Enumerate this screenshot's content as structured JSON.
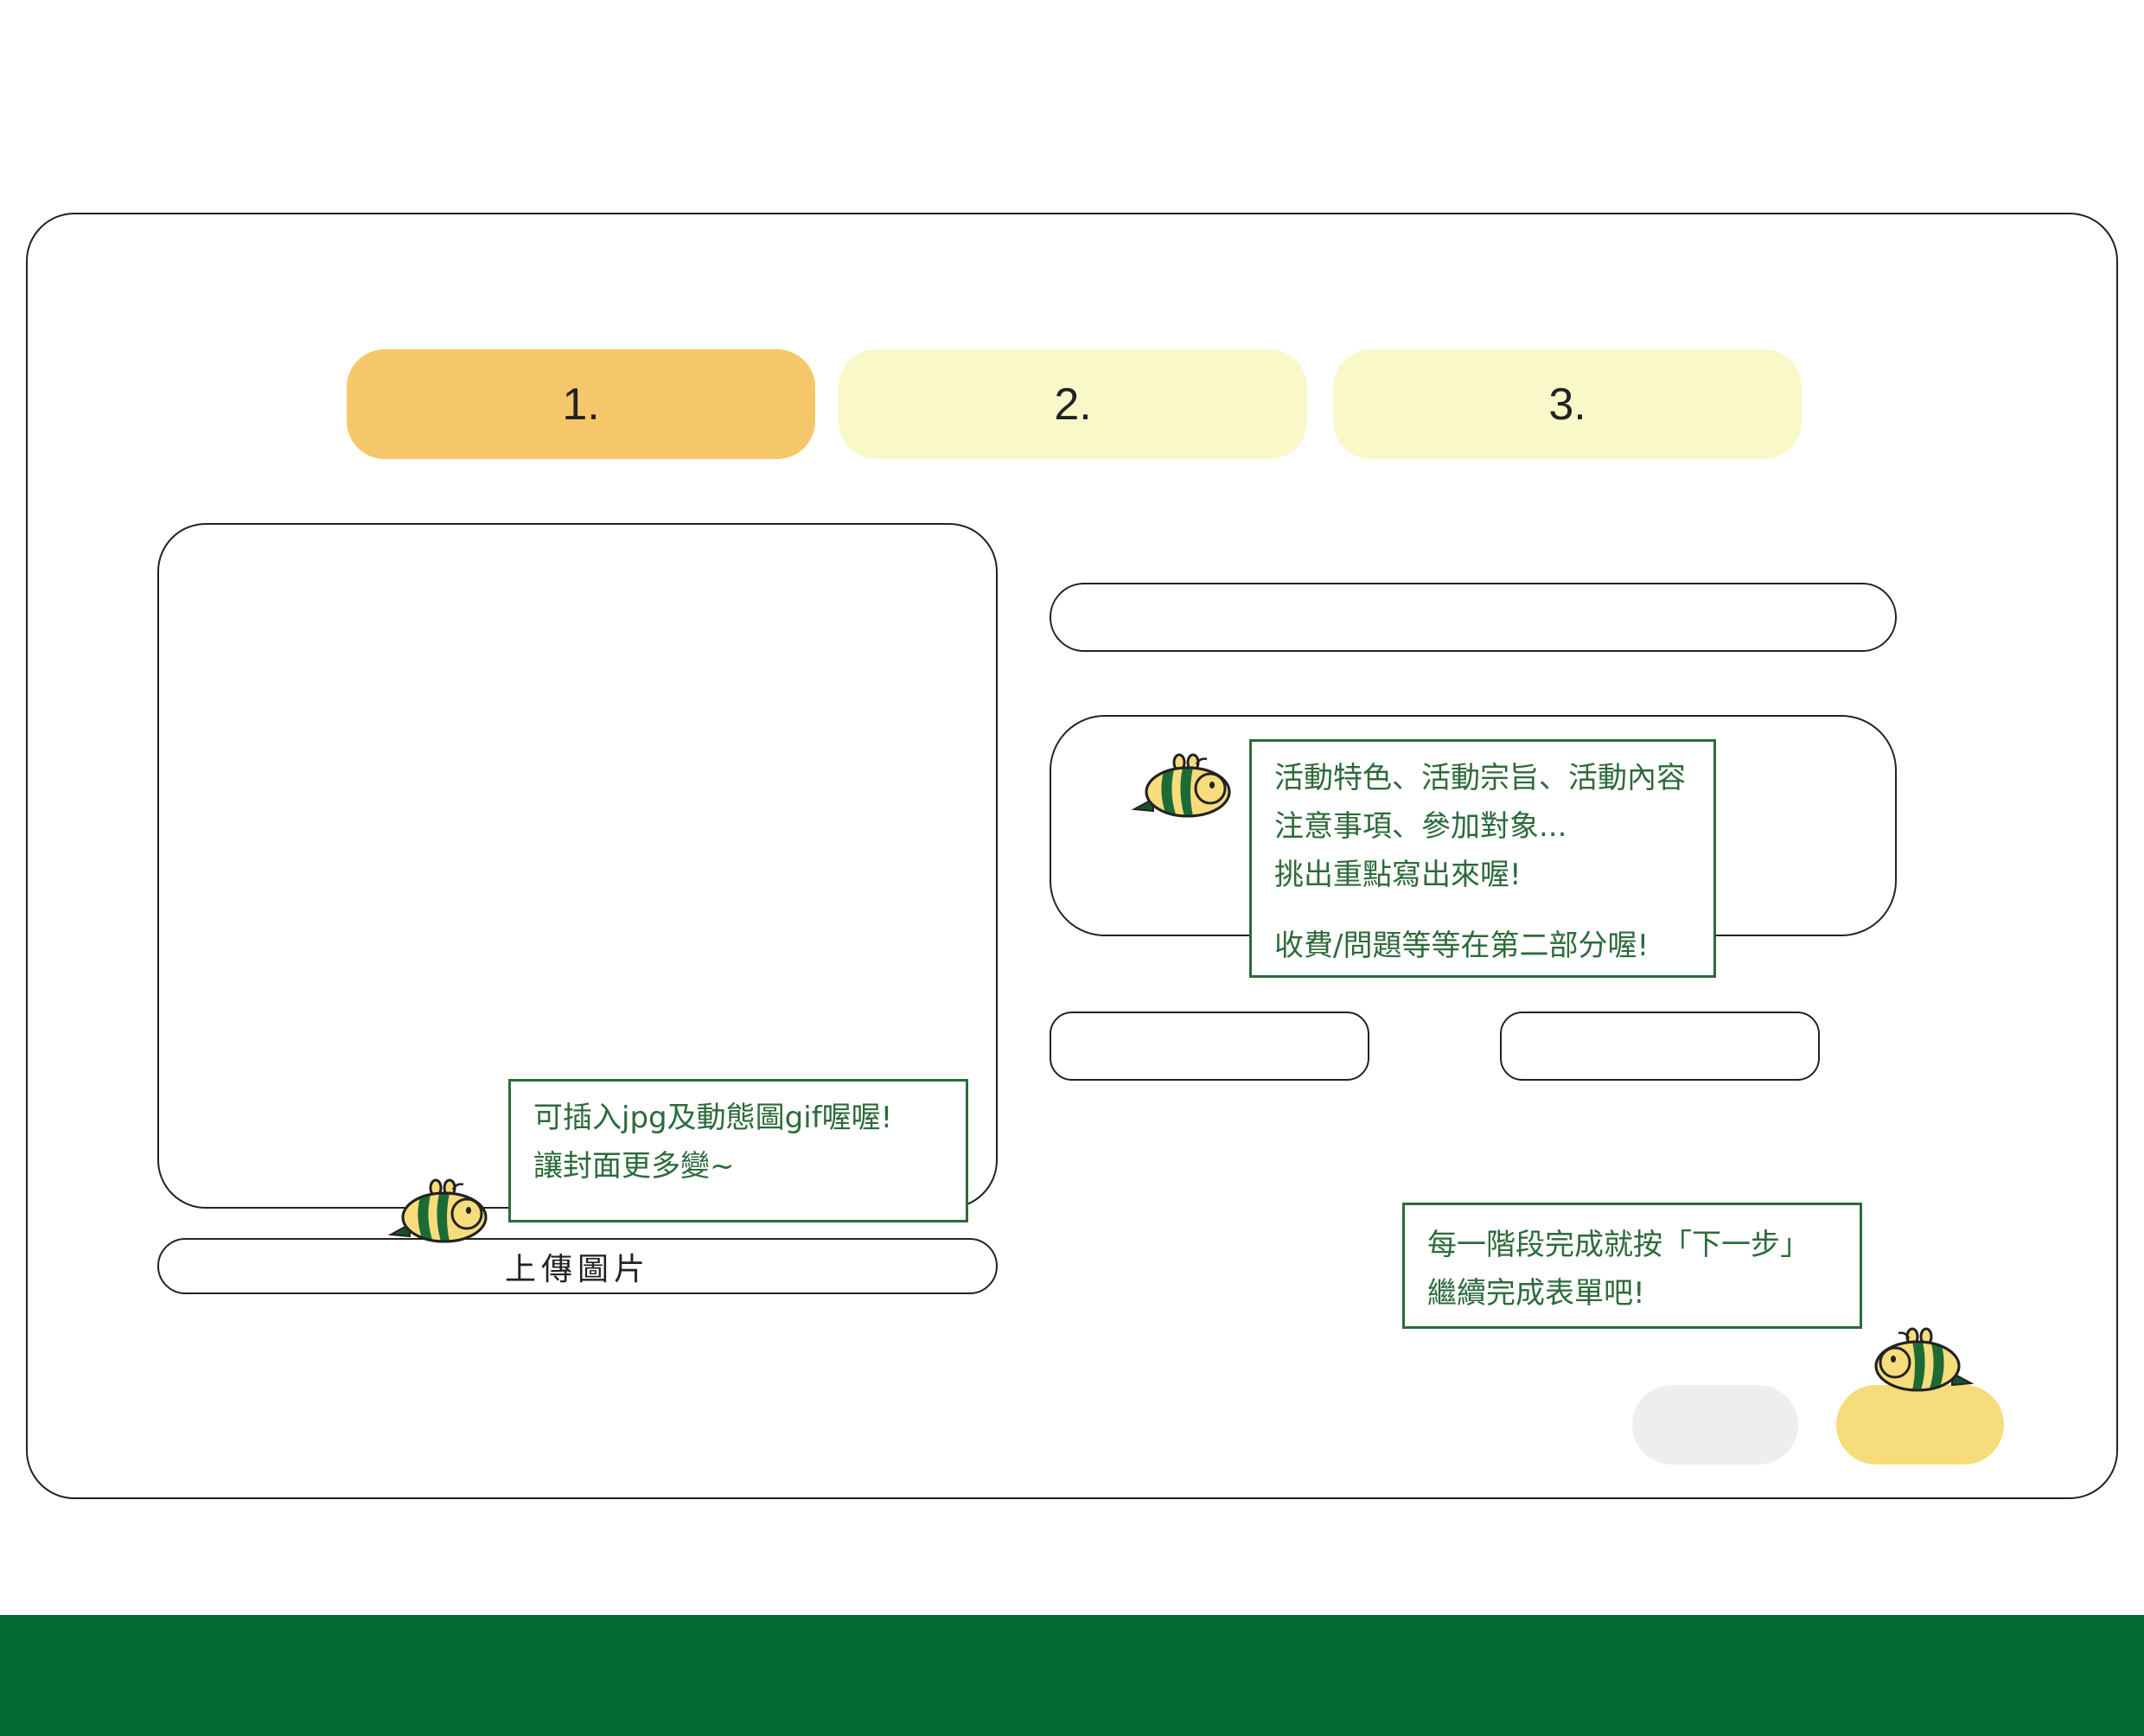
{
  "steps": [
    {
      "label": "1.",
      "active": true
    },
    {
      "label": "2.",
      "active": false
    },
    {
      "label": "3.",
      "active": false
    }
  ],
  "upload": {
    "button_label": "上傳圖片",
    "tip_lines": [
      "可插入jpg及動態圖gif喔喔!",
      "讓封面更多變~"
    ]
  },
  "description": {
    "tip_lines": [
      "活動特色、活動宗旨、活動內容",
      "注意事項、參加對象...",
      "挑出重點寫出來喔!"
    ],
    "tip_note": "收費/問題等等在第二部分喔!"
  },
  "next_tip": {
    "lines": [
      "每一階段完成就按「下一步」",
      "繼續完成表單吧!"
    ]
  },
  "colors": {
    "step_active": "#f6c76a",
    "step_inactive": "#f8f8c9",
    "tip_text": "#2d6a3a",
    "footer": "#026935",
    "next_button": "#f7dc7c",
    "prev_button": "#eeeeee"
  },
  "icons": {
    "mascot": "bee-icon"
  }
}
